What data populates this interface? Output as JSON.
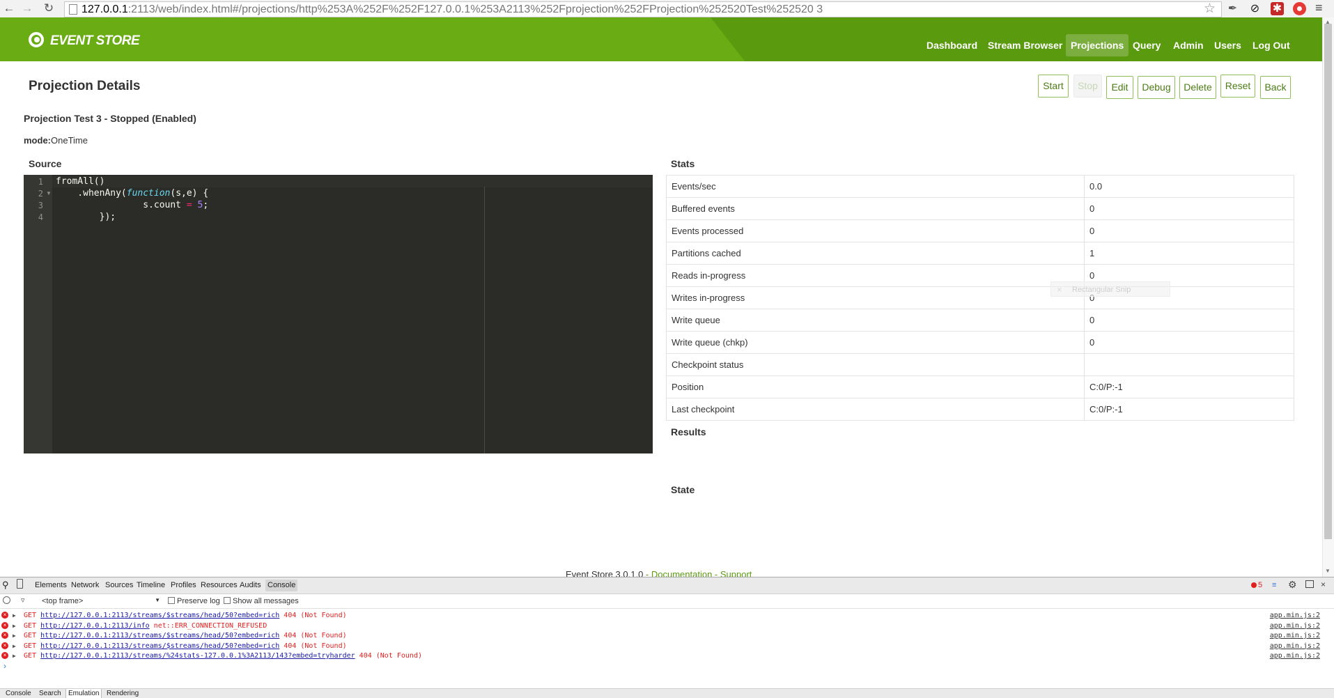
{
  "browser": {
    "url_host": "127.0.0.1",
    "url_rest": ":2113/web/index.html#/projections/http%253A%252F%252F127.0.0.1%253A2113%252Fprojection%252FProjection%252520Test%252520 3"
  },
  "header": {
    "logo_text": "EVENT STORE",
    "nav": [
      "Dashboard",
      "Stream Browser",
      "Projections",
      "Query",
      "Admin",
      "Users",
      "Log Out"
    ],
    "active_nav": "Projections"
  },
  "page": {
    "title": "Projection Details",
    "buttons": {
      "start": "Start",
      "stop": "Stop",
      "edit": "Edit",
      "debug": "Debug",
      "delete": "Delete",
      "reset": "Reset",
      "back": "Back"
    },
    "projection_status": "Projection Test 3 - Stopped (Enabled)",
    "mode_label": "mode:",
    "mode_value": "OneTime",
    "source_title": "Source",
    "stats_title": "Stats",
    "results_title": "Results",
    "state_title": "State"
  },
  "editor": {
    "line_numbers": [
      "1",
      "2",
      "3",
      "4"
    ],
    "lines": {
      "l1": "fromAll()",
      "l2_a": "    .whenAny(",
      "l2_kw": "function",
      "l2_b": "(s,e) {",
      "l3_a": "                s.count ",
      "l3_op": "=",
      "l3_sp": " ",
      "l3_num": "5",
      "l3_b": ";",
      "l4": "        });"
    }
  },
  "stats": [
    {
      "label": "Events/sec",
      "value": "0.0"
    },
    {
      "label": "Buffered events",
      "value": "0"
    },
    {
      "label": "Events processed",
      "value": "0"
    },
    {
      "label": "Partitions cached",
      "value": "1"
    },
    {
      "label": "Reads in-progress",
      "value": "0"
    },
    {
      "label": "Writes in-progress",
      "value": "0"
    },
    {
      "label": "Write queue",
      "value": "0"
    },
    {
      "label": "Write queue (chkp)",
      "value": "0"
    },
    {
      "label": "Checkpoint status",
      "value": ""
    },
    {
      "label": "Position",
      "value": "C:0/P:-1"
    },
    {
      "label": "Last checkpoint",
      "value": "C:0/P:-1"
    }
  ],
  "ghost_tooltip": "Rectangular Snip",
  "footer": {
    "version": "Event Store 3.0.1.0",
    "sep": " - ",
    "documentation": "Documentation",
    "support": "Support"
  },
  "devtools": {
    "tabs": [
      "Elements",
      "Network",
      "Sources",
      "Timeline",
      "Profiles",
      "Resources",
      "Audits",
      "Console"
    ],
    "active_tab": "Console",
    "error_count": "5",
    "frame": "<top frame>",
    "preserve_log": "Preserve log",
    "show_all": "Show all messages",
    "messages": [
      {
        "method": "GET",
        "url": "http://127.0.0.1:2113/streams/$streams/head/50?embed=rich",
        "status": "404 (Not Found)",
        "source": "app.min.js:2"
      },
      {
        "method": "GET",
        "url": "http://127.0.0.1:2113/info",
        "status": "net::ERR_CONNECTION_REFUSED",
        "source": "app.min.js:2"
      },
      {
        "method": "GET",
        "url": "http://127.0.0.1:2113/streams/$streams/head/50?embed=rich",
        "status": "404 (Not Found)",
        "source": "app.min.js:2"
      },
      {
        "method": "GET",
        "url": "http://127.0.0.1:2113/streams/$streams/head/50?embed=rich",
        "status": "404 (Not Found)",
        "source": "app.min.js:2"
      },
      {
        "method": "GET",
        "url": "http://127.0.0.1:2113/streams/%24stats-127.0.0.1%3A2113/143?embed=tryharder",
        "status": "404 (Not Found)",
        "source": "app.min.js:2"
      }
    ],
    "drawer_tabs": [
      "Console",
      "Search",
      "Emulation",
      "Rendering"
    ],
    "drawer_active": "Emulation"
  },
  "colors": {
    "header_green": "#6aac13",
    "accent_green": "#5a9a0e",
    "error_red": "#e02020"
  }
}
